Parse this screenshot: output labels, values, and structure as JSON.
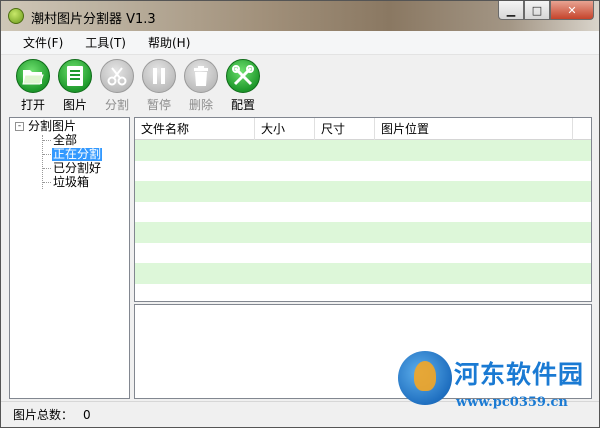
{
  "window": {
    "title": "潮村图片分割器 V1.3",
    "buttons": {
      "minimize": "▁",
      "maximize": "□",
      "close": "✕"
    }
  },
  "menu": [
    {
      "label": "文件(F)"
    },
    {
      "label": "工具(T)"
    },
    {
      "label": "帮助(H)"
    }
  ],
  "toolbar": [
    {
      "label": "打开",
      "icon": "folder-open-icon",
      "enabled": true
    },
    {
      "label": "图片",
      "icon": "image-document-icon",
      "enabled": true
    },
    {
      "label": "分割",
      "icon": "scissors-icon",
      "enabled": false
    },
    {
      "label": "暂停",
      "icon": "pause-icon",
      "enabled": false
    },
    {
      "label": "删除",
      "icon": "trash-icon",
      "enabled": false
    },
    {
      "label": "配置",
      "icon": "wrench-screwdriver-icon",
      "enabled": true
    }
  ],
  "tree": {
    "root": "分割图片",
    "expander": "-",
    "children": [
      {
        "label": "全部"
      },
      {
        "label": "正在分割",
        "selected": true
      },
      {
        "label": "已分割好"
      },
      {
        "label": "垃圾箱"
      }
    ]
  },
  "list": {
    "columns": [
      "文件名称",
      "大小",
      "尺寸",
      "图片位置"
    ],
    "rows": []
  },
  "status": {
    "label": "图片总数：",
    "count": "0"
  },
  "watermark": {
    "text": "河东软件园",
    "url": "www.pc0359.cn"
  },
  "colors": {
    "row_alt": "#ddf7d9",
    "selection": "#3399ff",
    "tool_enabled": "#1f9a2c",
    "watermark": "#1a7ad3"
  }
}
